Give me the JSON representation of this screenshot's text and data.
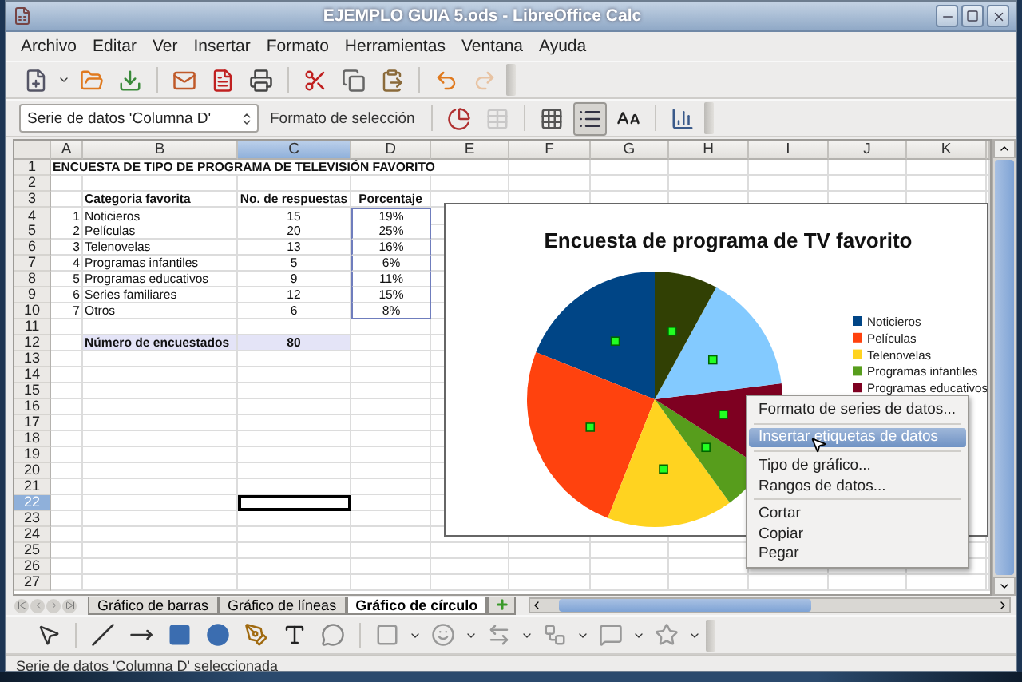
{
  "window": {
    "title": "EJEMPLO GUIA 5.ods - LibreOffice Calc"
  },
  "menu_bar": [
    "Archivo",
    "Editar",
    "Ver",
    "Insertar",
    "Formato",
    "Herramientas",
    "Ventana",
    "Ayuda"
  ],
  "standard_toolbar": [
    {
      "disabled": false
    },
    {
      "disabled": false
    },
    {
      "disabled": false
    },
    {
      "disabled": false
    },
    {
      "disabled": false
    },
    {
      "disabled": false
    },
    {
      "disabled": false
    },
    {
      "disabled": false
    },
    {
      "disabled": false
    },
    {
      "disabled": false
    },
    {
      "disabled": true
    }
  ],
  "chart_toolbar": {
    "element_select": "Serie de datos 'Columna D'",
    "format_button": "Formato de selección",
    "buttons": [
      {
        "pressed": false,
        "disabled": false
      },
      {
        "pressed": false,
        "disabled": true
      },
      {
        "pressed": false,
        "disabled": false
      },
      {
        "pressed": true,
        "disabled": false
      },
      {
        "pressed": false,
        "disabled": false
      },
      {
        "pressed": false,
        "disabled": false
      }
    ]
  },
  "sheet": {
    "columns": [
      {
        "label": "A",
        "selected": false
      },
      {
        "label": "B",
        "selected": false
      },
      {
        "label": "C",
        "selected": true
      },
      {
        "label": "D",
        "selected": false
      },
      {
        "label": "E",
        "selected": false
      },
      {
        "label": "F",
        "selected": false
      },
      {
        "label": "G",
        "selected": false
      },
      {
        "label": "H",
        "selected": false
      },
      {
        "label": "I",
        "selected": false
      },
      {
        "label": "J",
        "selected": false
      },
      {
        "label": "K",
        "selected": false
      }
    ],
    "rows": [
      {
        "number": "1",
        "selected": false,
        "bold": true,
        "shaded": false,
        "a": "ENCUESTA DE TIPO DE PROGRAMA DE TELEVISIÓN FAVORITO"
      },
      {
        "number": "2",
        "selected": false
      },
      {
        "number": "3",
        "selected": false,
        "bold": true,
        "shaded": false,
        "in_range": false,
        "b": "Categoria favorita",
        "c": "No. de respuestas",
        "d": "Porcentaje"
      },
      {
        "number": "4",
        "selected": false,
        "bold": false,
        "shaded": false,
        "in_range": true,
        "a": "1",
        "b": "Noticieros",
        "c": "15",
        "d": "19%"
      },
      {
        "number": "5",
        "selected": false,
        "bold": false,
        "shaded": false,
        "in_range": true,
        "a": "2",
        "b": "Películas",
        "c": "20",
        "d": "25%"
      },
      {
        "number": "6",
        "selected": false,
        "bold": false,
        "shaded": false,
        "in_range": true,
        "a": "3",
        "b": "Telenovelas",
        "c": "13",
        "d": "16%"
      },
      {
        "number": "7",
        "selected": false,
        "bold": false,
        "shaded": false,
        "in_range": true,
        "a": "4",
        "b": "Programas infantiles",
        "c": "5",
        "d": "6%"
      },
      {
        "number": "8",
        "selected": false,
        "bold": false,
        "shaded": false,
        "in_range": true,
        "a": "5",
        "b": "Programas educativos",
        "c": "9",
        "d": "11%"
      },
      {
        "number": "9",
        "selected": false,
        "bold": false,
        "shaded": false,
        "in_range": true,
        "a": "6",
        "b": "Series familiares",
        "c": "12",
        "d": "15%"
      },
      {
        "number": "10",
        "selected": false,
        "bold": false,
        "shaded": false,
        "in_range": true,
        "a": "7",
        "b": "Otros",
        "c": "6",
        "d": "8%"
      },
      {
        "number": "11",
        "selected": false
      },
      {
        "number": "12",
        "selected": false,
        "bold": true,
        "shaded": true,
        "b": "Número de encuestados",
        "c": "80"
      },
      {
        "number": "13",
        "selected": false
      },
      {
        "number": "14",
        "selected": false
      },
      {
        "number": "15",
        "selected": false
      },
      {
        "number": "16",
        "selected": false
      },
      {
        "number": "17",
        "selected": false
      },
      {
        "number": "18",
        "selected": false
      },
      {
        "number": "19",
        "selected": false
      },
      {
        "number": "20",
        "selected": false
      },
      {
        "number": "21",
        "selected": false
      },
      {
        "number": "22",
        "selected": true
      },
      {
        "number": "23",
        "selected": false
      },
      {
        "number": "24",
        "selected": false
      },
      {
        "number": "25",
        "selected": false
      },
      {
        "number": "26",
        "selected": false
      },
      {
        "number": "27",
        "selected": false
      }
    ]
  },
  "chart": {
    "series_selected": true,
    "chart_data": {
      "type": "pie",
      "title": "Encuesta de programa de TV favorito",
      "legend": "right",
      "categories": [
        "Noticieros",
        "Películas",
        "Telenovelas",
        "Programas infantiles",
        "Programas educativos",
        null,
        null
      ],
      "values": [
        0.19,
        0.25,
        0.16,
        0.06,
        0.11,
        0.15,
        0.08
      ],
      "colors": [
        "#004586",
        "#ff420e",
        "#ffd320",
        "#579d1c",
        "#7e0021",
        "#83caff",
        "#314004"
      ]
    }
  },
  "context_menu": {
    "groups": [
      {
        "items": [
          {
            "label": "Formato de series de datos...",
            "selected": false
          }
        ]
      },
      {
        "items": [
          {
            "label": "Insertar etiquetas de datos",
            "selected": true
          }
        ]
      },
      {
        "items": [
          {
            "label": "Tipo de gráfico...",
            "selected": false
          },
          {
            "label": "Rangos de datos...",
            "selected": false
          }
        ]
      },
      {
        "items": [
          {
            "label": "Cortar",
            "selected": false
          },
          {
            "label": "Copiar",
            "selected": false
          },
          {
            "label": "Pegar",
            "selected": false
          }
        ]
      }
    ]
  },
  "sheet_tabs": [
    {
      "label": "Gráfico de barras",
      "selected": false
    },
    {
      "label": "Gráfico de líneas",
      "selected": false
    },
    {
      "label": "Gráfico de círculo",
      "selected": true
    }
  ],
  "status_bar": {
    "text": "Serie de datos 'Columna D' seleccionada"
  }
}
